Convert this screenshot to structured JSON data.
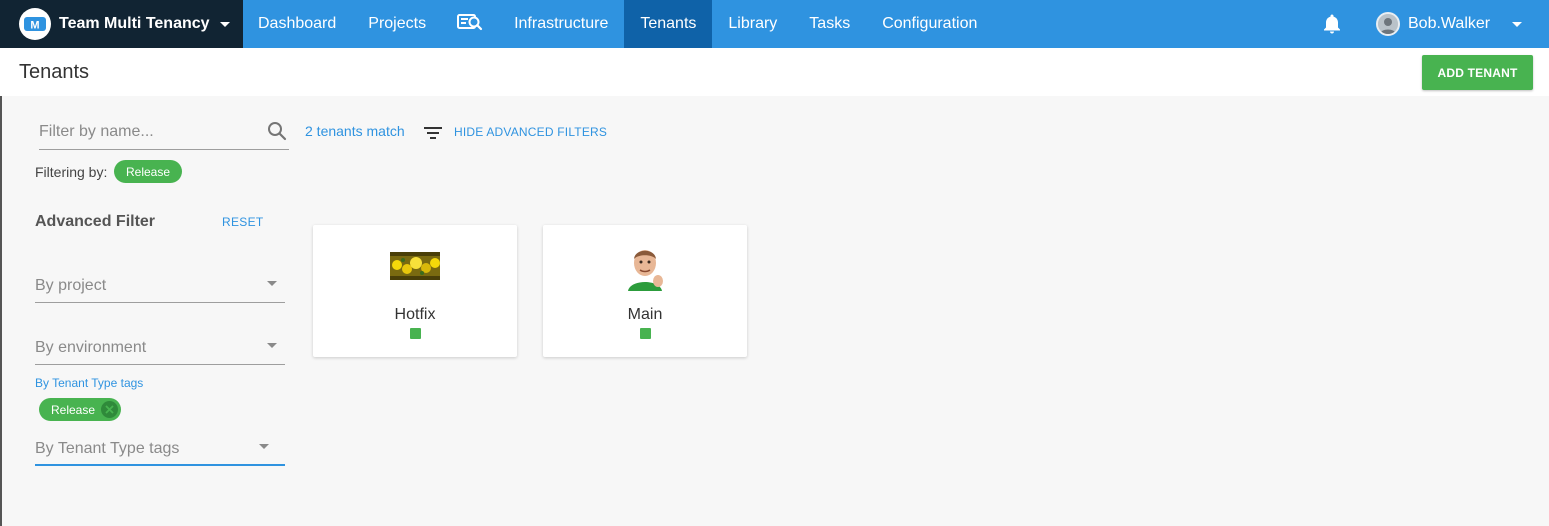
{
  "topnav": {
    "space": {
      "name": "Team Multi Tenancy",
      "logo_icon": "octopus-logo-icon"
    },
    "items": [
      {
        "label": "Dashboard",
        "active": false
      },
      {
        "label": "Projects",
        "active": false
      },
      {
        "icon": "search-deployments-icon",
        "active": false
      },
      {
        "label": "Infrastructure",
        "active": false
      },
      {
        "label": "Tenants",
        "active": true
      },
      {
        "label": "Library",
        "active": false
      },
      {
        "label": "Tasks",
        "active": false
      },
      {
        "label": "Configuration",
        "active": false
      }
    ],
    "notifications_icon": "bell-icon",
    "user": {
      "name": "Bob.Walker",
      "avatar_icon": "user-avatar"
    }
  },
  "header": {
    "title": "Tenants",
    "add_button": "ADD TENANT"
  },
  "filters": {
    "search_placeholder": "Filter by name...",
    "search_value": "",
    "filtering_by_label": "Filtering by:",
    "active_filter_chip": "Release",
    "match_count": "2 tenants match",
    "toggle_advanced": "HIDE ADVANCED FILTERS",
    "advanced": {
      "title": "Advanced Filter",
      "reset": "RESET",
      "project_select": "By project",
      "environment_select": "By environment",
      "tags_field_label": "By Tenant Type tags",
      "tags_chip": "Release",
      "tags_select": "By Tenant Type tags"
    }
  },
  "tenants": [
    {
      "name": "Hotfix",
      "logo": "yellow-flowers-image",
      "env_status_color": "#48b350"
    },
    {
      "name": "Main",
      "logo": "success-kid-image",
      "env_status_color": "#48b350"
    }
  ],
  "colors": {
    "nav_blue": "#2f93e0",
    "nav_active": "#0f62a8",
    "space_bg": "#112433",
    "green": "#48b350",
    "link_blue": "#2f93e0"
  }
}
